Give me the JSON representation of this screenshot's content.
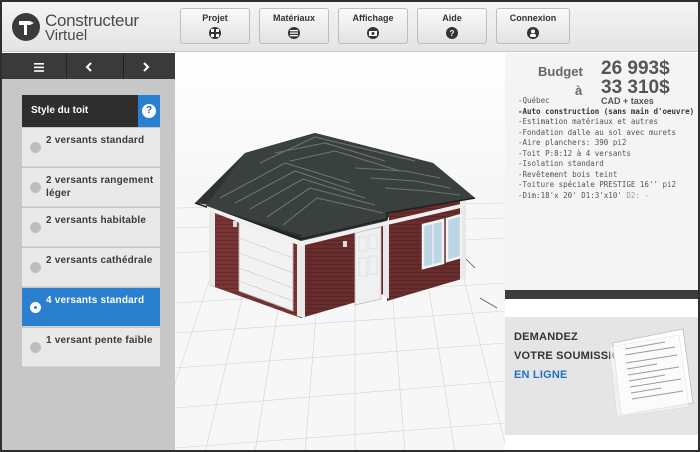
{
  "app": {
    "logo_line1": "Constructeur",
    "logo_line2": "Virtuel"
  },
  "nav": [
    {
      "label": "Projet",
      "icon": "grid-icon"
    },
    {
      "label": "Matériaux",
      "icon": "list-icon"
    },
    {
      "label": "Affichage",
      "icon": "camera-icon"
    },
    {
      "label": "Aide",
      "icon": "question-icon"
    },
    {
      "label": "Connexion",
      "icon": "user-icon"
    }
  ],
  "toolbar": {
    "menu_icon": "menu-icon",
    "prev_icon": "chevron-left-icon",
    "next_icon": "chevron-right-icon"
  },
  "panel": {
    "title": "Style du toit",
    "help": "?",
    "options": [
      {
        "label": "2 versants standard",
        "selected": false
      },
      {
        "label": "2 versants rangement léger",
        "selected": false
      },
      {
        "label": "2 versants habitable",
        "selected": false
      },
      {
        "label": "2 versants cathédrale",
        "selected": false
      },
      {
        "label": "4 versants standard",
        "selected": true
      },
      {
        "label": "1 versant pente faible",
        "selected": false
      }
    ]
  },
  "budget": {
    "label": "Budget",
    "min": "26 993$",
    "separator": "à",
    "max": "33 310$",
    "unit": "CAD + taxes"
  },
  "specs": [
    {
      "text": "-Québec",
      "bold": false
    },
    {
      "text": "-Auto construction (sans main d'oeuvre)",
      "bold": true
    },
    {
      "text": "-Estimation matériaux et autres",
      "bold": false
    },
    {
      "text": "-Fondation dalle au sol avec murets",
      "bold": false
    },
    {
      "text": "-Aire planchers: 390 pi2",
      "bold": false
    },
    {
      "text": "-Toit P:8:12  à 4 versants",
      "bold": false
    },
    {
      "text": "-Isolation standard",
      "bold": false
    },
    {
      "text": "-Revêtement bois teint",
      "bold": false
    },
    {
      "text": "-Toiture spéciale PRESTIGE 16'' pi2",
      "bold": false
    },
    {
      "text": "-Dim:18'x 20'  D1:3'x10'",
      "bold": false,
      "extra": "D2: -"
    }
  ],
  "promo": {
    "line1": "DEMANDEZ",
    "line2": "VOTRE SOUMISSION",
    "line3": "EN LIGNE"
  },
  "colors": {
    "accent": "#2b7fcf",
    "dark": "#3a3a3a",
    "wall": "#7a3535",
    "roof": "#3a3f3d"
  }
}
